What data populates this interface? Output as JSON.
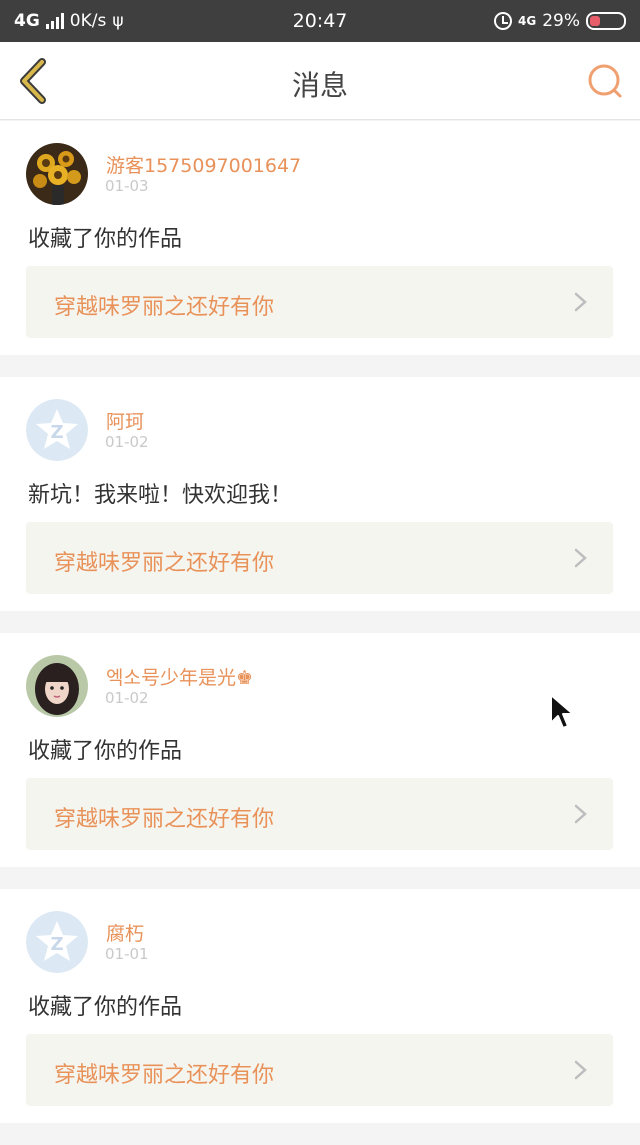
{
  "status_bar": {
    "network": "4G",
    "speed": "0K/s",
    "time": "20:47",
    "network_right": "4G",
    "battery": "29%"
  },
  "header": {
    "title": "消息"
  },
  "messages": [
    {
      "username": "游客1575097001647",
      "date": "01-03",
      "text": "收藏了你的作品",
      "work_title": "穿越味罗丽之还好有你",
      "avatar": "sunflower-photo"
    },
    {
      "username": "阿珂",
      "date": "01-02",
      "text": "新坑！我来啦！快欢迎我！",
      "work_title": "穿越味罗丽之还好有你",
      "avatar": "default-z"
    },
    {
      "username": "엑소号少年是光♚",
      "date": "01-02",
      "text": "收藏了你的作品",
      "work_title": "穿越味罗丽之还好有你",
      "avatar": "girl-photo"
    },
    {
      "username": "腐朽",
      "date": "01-01",
      "text": "收藏了你的作品",
      "work_title": "穿越味罗丽之还好有你",
      "avatar": "default-z"
    }
  ],
  "colors": {
    "accent": "#e8925a",
    "back_arrow": "#d8b84a",
    "status_bar": "#3f3f3f"
  }
}
